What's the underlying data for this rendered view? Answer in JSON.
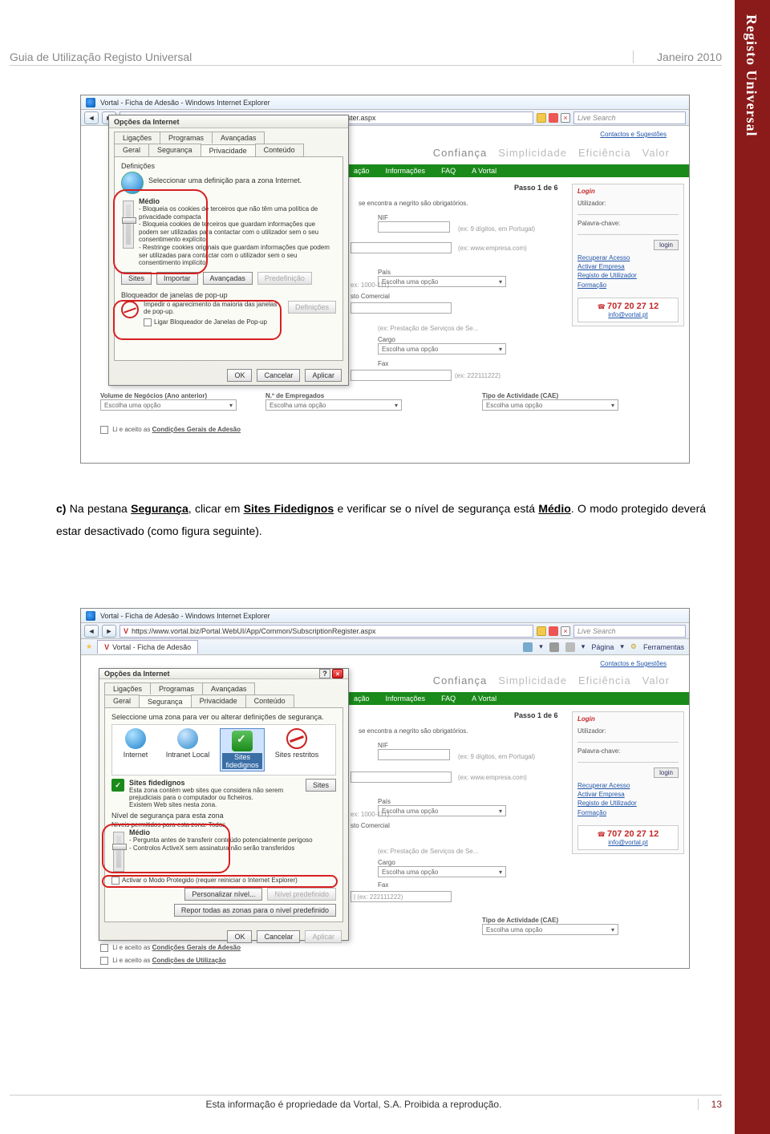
{
  "sidebar_text": "Registo Universal",
  "header": {
    "left": "Guia de Utilização Registo Universal",
    "right": "Janeiro 2010"
  },
  "footer": {
    "left": "Esta informação é propriedade da Vortal, S.A. Proibida a reprodução.",
    "page": "13"
  },
  "body": {
    "c_label": "c)",
    "line1a": "Na pestana ",
    "seg": "Segurança",
    "line1b": ", clicar em ",
    "sites": "Sites Fidedignos",
    "line1c": " e verificar se o nível de segurança está ",
    "medio": "Médio",
    "line1d": ". O modo protegido deverá estar desactivado (como figura seguinte)."
  },
  "ie": {
    "title": "Vortal - Ficha de Adesão - Windows Internet Explorer",
    "url": "https://www.vortal.biz/Portal.WebUI/App/Common/SubscriptionRegister.aspx",
    "search": "Live Search",
    "tab": "Vortal - Ficha de Adesão",
    "tool_pagina": "Página",
    "tool_ferramentas": "Ferramentas"
  },
  "dialog1": {
    "title": "Opções da Internet",
    "tabs_row1": [
      "Ligações",
      "Programas",
      "Avançadas"
    ],
    "tabs_row2": [
      "Geral",
      "Segurança",
      "Privacidade",
      "Conteúdo"
    ],
    "defs": "Definições",
    "sel_def": "Seleccionar uma definição para a zona Internet.",
    "medio": "Médio",
    "bullets": [
      "- Bloqueia os cookies de terceiros que não têm uma política de privacidade compacta",
      "- Bloqueia cookies de terceiros que guardam informações que podem ser utilizadas para contactar com o utilizador sem o seu consentimento explícito",
      "- Restringe cookies originais que guardam informações que podem ser utilizadas para contactar com o utilizador sem o seu consentimento implícito"
    ],
    "btn_sites": "Sites",
    "btn_importar": "Importar",
    "btn_avancadas": "Avançadas",
    "btn_predef": "Predefinição",
    "popup_title": "Bloqueador de janelas de pop-up",
    "popup_line": "Impedir o aparecimento da maioria das janelas de pop-up.",
    "popup_chk": "Ligar Bloqueador de Janelas de Pop-up",
    "btn_def": "Definições",
    "ok": "OK",
    "cancel": "Cancelar",
    "apply": "Aplicar"
  },
  "dialog2": {
    "title": "Opções da Internet",
    "tabs_row1": [
      "Ligações",
      "Programas",
      "Avançadas"
    ],
    "tabs_row2": [
      "Geral",
      "Segurança",
      "Privacidade",
      "Conteúdo"
    ],
    "intro": "Seleccione uma zona para ver ou alterar definições de segurança.",
    "zones": [
      "Internet",
      "Intranet Local",
      "Sites fidedignos",
      "Sites restritos"
    ],
    "trusted_title": "Sites fidedignos",
    "trusted_desc": "Esta zona contém web sites que considera não serem prejudiciais para o computador ou ficheiros.\nExistem Web sites nesta zona.",
    "btn_sites": "Sites",
    "sec_level_title": "Nível de segurança para esta zona",
    "levels_line": "Níveis permitidos para esta zona: Todos",
    "medio": "Médio",
    "bullets": [
      "- Pergunta antes de transferir conteúdo potencialmente perigoso",
      "- Controlos ActiveX sem assinatura não serão transferidos"
    ],
    "protect_chk": "Activar o Modo Protegido (requer reiniciar o Internet Explorer)",
    "btn_pers": "Personalizar nível...",
    "btn_predef": "Nível predefinido",
    "btn_repor": "Repor todas as zonas para o nível predefinido",
    "ok": "OK",
    "cancel": "Cancelar",
    "apply": "Aplicar"
  },
  "bg": {
    "branding": [
      "Confiança",
      "Simplicidade",
      "Eficiência",
      "Valor"
    ],
    "nav": [
      "ação",
      "Informações",
      "FAQ",
      "A Vortal"
    ],
    "passo": "Passo 1 de 6",
    "obrig": "se encontra a negrito são obrigatórios.",
    "contactos": "Contactos e Sugestões",
    "login_head": "Login",
    "utilizador": "Utilizador:",
    "palavra": "Palavra-chave:",
    "login_btn": "login",
    "links": [
      "Recuperar Acesso",
      "Activar Empresa",
      "Registo de Utilizador",
      "Formação"
    ],
    "phone": "707 20 27 12",
    "mail": "info@vortal.pt",
    "nif": "NIF",
    "nif_hint": "(ex: 9 dígitos, em Portugal)",
    "empresa_hint": "(ex: www.empresa.com)",
    "pais": "País",
    "escolha": "Escolha uma opção",
    "tel_hint": "ex: 1000-111)",
    "sto": "sto Comercial",
    "prest_hint": "(ex: Prestação de Serviços de Se...",
    "cargo": "Cargo",
    "fax": "Fax",
    "fax_hint": "(ex: 222111222)",
    "vol": "Volume de Negócios (Ano anterior)",
    "emp": "N.º de Empregados",
    "tipo": "Tipo de Actividade (CAE)",
    "cond1": "Li e aceito as Condições Gerais de Adesão",
    "cond2": "Li e aceito as Condições de Utilização"
  }
}
